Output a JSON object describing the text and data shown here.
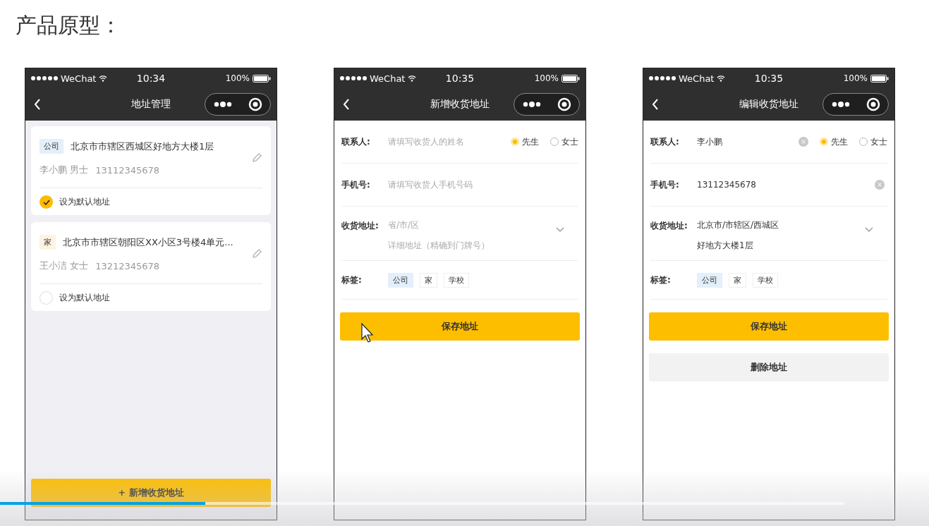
{
  "heading": "产品原型：",
  "phones": [
    {
      "kind": "list",
      "status": {
        "carrier": "WeChat",
        "time": "10:34",
        "battery": "100%"
      },
      "nav_title": "地址管理",
      "addresses": [
        {
          "tag": "公司",
          "color": "#e3effa",
          "address": "北京市市辖区西城区好地方大楼1层",
          "contact": "李小鹏 男士",
          "phone": "13112345678",
          "default_label": "设为默认地址",
          "checked": true
        },
        {
          "tag": "家",
          "color": "#fdf3e1",
          "address": "北京市市辖区朝阳区XX小区3号楼4单元...",
          "contact": "王小洁 女士",
          "phone": "13212345678",
          "default_label": "设为默认地址",
          "checked": false
        }
      ],
      "add_button": "+ 新增收货地址"
    },
    {
      "kind": "form",
      "status": {
        "carrier": "WeChat",
        "time": "10:35",
        "battery": "100%"
      },
      "nav_title": "新增收货地址",
      "rows": [
        {
          "kind": "name",
          "label": "联系人:",
          "placeholder": "请填写收货人的姓名",
          "clearable": false,
          "genders": [
            {
              "label": "先生",
              "selected": true
            },
            {
              "label": "女士",
              "selected": false
            }
          ]
        },
        {
          "kind": "phone",
          "label": "手机号:",
          "placeholder": "请填写收货人手机号码",
          "clearable": false
        },
        {
          "kind": "address",
          "label": "收货地址:",
          "region_placeholder": "省/市/区",
          "detail_placeholder": "详细地址（精确到门牌号）"
        },
        {
          "kind": "tags",
          "label": "标签:",
          "tags": [
            {
              "label": "公司",
              "selected": true
            },
            {
              "label": "家",
              "selected": false
            },
            {
              "label": "学校",
              "selected": false
            }
          ]
        }
      ],
      "buttons": [
        {
          "kind": "primary",
          "label": "保存地址"
        }
      ]
    },
    {
      "kind": "form",
      "status": {
        "carrier": "WeChat",
        "time": "10:35",
        "battery": "100%"
      },
      "nav_title": "编辑收货地址",
      "rows": [
        {
          "kind": "name",
          "label": "联系人:",
          "value": "李小鹏",
          "clearable": true,
          "genders": [
            {
              "label": "先生",
              "selected": true
            },
            {
              "label": "女士",
              "selected": false
            }
          ]
        },
        {
          "kind": "phone",
          "label": "手机号:",
          "value": "13112345678",
          "clearable": true
        },
        {
          "kind": "address",
          "label": "收货地址:",
          "region": "北京市/市辖区/西城区",
          "detail": "好地方大楼1层"
        },
        {
          "kind": "tags",
          "label": "标签:",
          "tags": [
            {
              "label": "公司",
              "selected": true
            },
            {
              "label": "家",
              "selected": false
            },
            {
              "label": "学校",
              "selected": false
            }
          ]
        }
      ],
      "buttons": [
        {
          "kind": "primary",
          "label": "保存地址"
        },
        {
          "kind": "secondary",
          "label": "删除地址"
        }
      ]
    }
  ],
  "player": {
    "level": 0.243
  }
}
